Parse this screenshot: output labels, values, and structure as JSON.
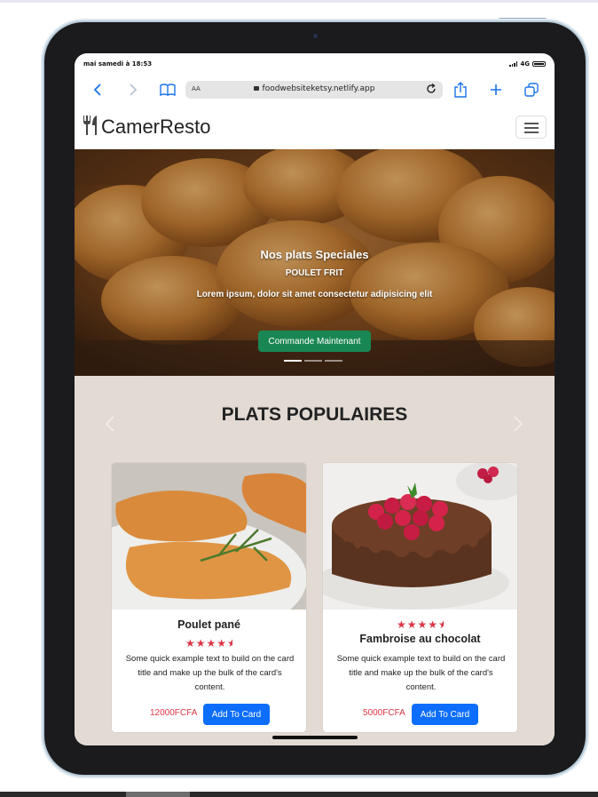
{
  "status_bar": {
    "time": "mai samedi à 18:53",
    "network": "4G"
  },
  "browser": {
    "text_size": "AA",
    "url": "foodwebsiteketsy.netlify.app"
  },
  "site": {
    "brand": "CamerResto"
  },
  "hero": {
    "title": "Nos plats Speciales",
    "subtitle": "POULET FRIT",
    "description": "Lorem ipsum, dolor sit amet consectetur adipisicing elit",
    "button": "Commande Maintenant",
    "slide_count": 3,
    "active_slide": 1
  },
  "popular": {
    "title": "PLATS POPULAIRES",
    "cards": [
      {
        "name": "Poulet pané",
        "rating": 4.5,
        "text": "Some quick example text to build on the card title and make up the bulk of the card's content.",
        "price": "12000FCFA",
        "button": "Add To Card"
      },
      {
        "name": "Fambroise au chocolat",
        "rating": 4.5,
        "text": "Some quick example text to build on the card title and make up the bulk of the card's content.",
        "price": "5000FCFA",
        "button": "Add To Card"
      }
    ]
  },
  "icons": {
    "back": "chevron-left-icon",
    "forward": "chevron-right-icon",
    "bookmarks": "book-icon",
    "lock": "lock-icon",
    "reload": "reload-icon",
    "share": "share-icon",
    "new_tab": "plus-icon",
    "tabs": "tabs-icon",
    "brand": "fork-knife-icon",
    "menu": "hamburger-icon",
    "star": "star-icon"
  },
  "colors": {
    "hero_button": "#198754",
    "card_button": "#0d6efd",
    "price": "#dc3545",
    "stars": "#dc3545",
    "section_background": "#e2dad3",
    "browser_accent": "#1a73e8"
  }
}
